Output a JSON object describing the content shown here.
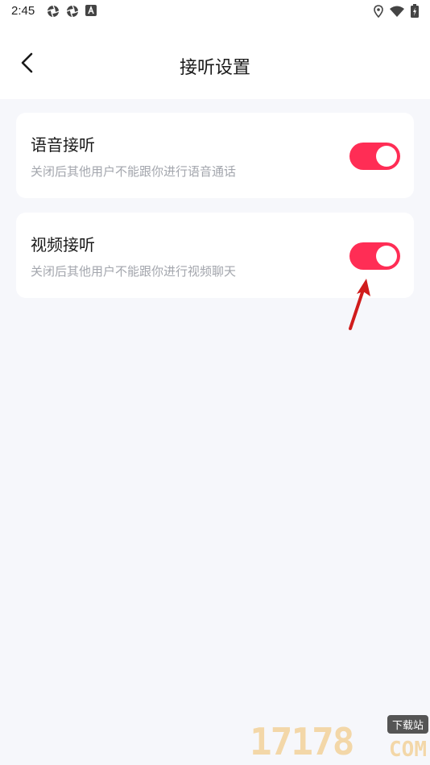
{
  "status_bar": {
    "time": "2:45"
  },
  "header": {
    "title": "接听设置",
    "back_icon": "chevron-left-icon"
  },
  "settings": [
    {
      "label": "语音接听",
      "description": "关闭后其他用户不能跟你进行语音通话",
      "enabled": true
    },
    {
      "label": "视频接听",
      "description": "关闭后其他用户不能跟你进行视频聊天",
      "enabled": true
    }
  ],
  "colors": {
    "accent": "#ff2d55",
    "background": "#f6f7fb",
    "card": "#ffffff",
    "annotation_arrow": "#d01c1c"
  },
  "watermark": {
    "digits": "17178",
    "site_label": "下载站",
    "domain_suffix": "COM"
  }
}
